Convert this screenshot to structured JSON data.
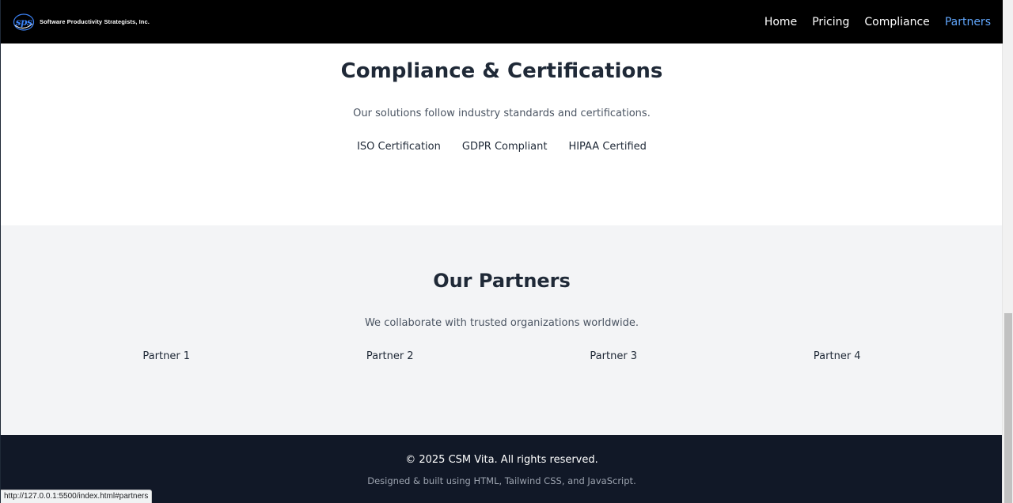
{
  "header": {
    "brand_name": "Software Productivity Strategists, Inc.",
    "logo_text": "sps",
    "nav": [
      {
        "label": "Home",
        "active": false
      },
      {
        "label": "Pricing",
        "active": false
      },
      {
        "label": "Compliance",
        "active": false
      },
      {
        "label": "Partners",
        "active": true
      }
    ],
    "active_color": "#60a5fa"
  },
  "compliance": {
    "title": "Compliance & Certifications",
    "subtitle": "Our solutions follow industry standards and certifications.",
    "certifications": [
      "ISO Certification",
      "GDPR Compliant",
      "HIPAA Certified"
    ]
  },
  "partners": {
    "title": "Our Partners",
    "subtitle": "We collaborate with trusted organizations worldwide.",
    "items": [
      "Partner 1",
      "Partner 2",
      "Partner 3",
      "Partner 4"
    ]
  },
  "footer": {
    "copyright": "© 2025 CSM Vita. All rights reserved.",
    "built_with": "Designed & built using HTML, Tailwind CSS, and JavaScript."
  },
  "status_bar": {
    "url": "http://127.0.0.1:5500/index.html#partners"
  }
}
